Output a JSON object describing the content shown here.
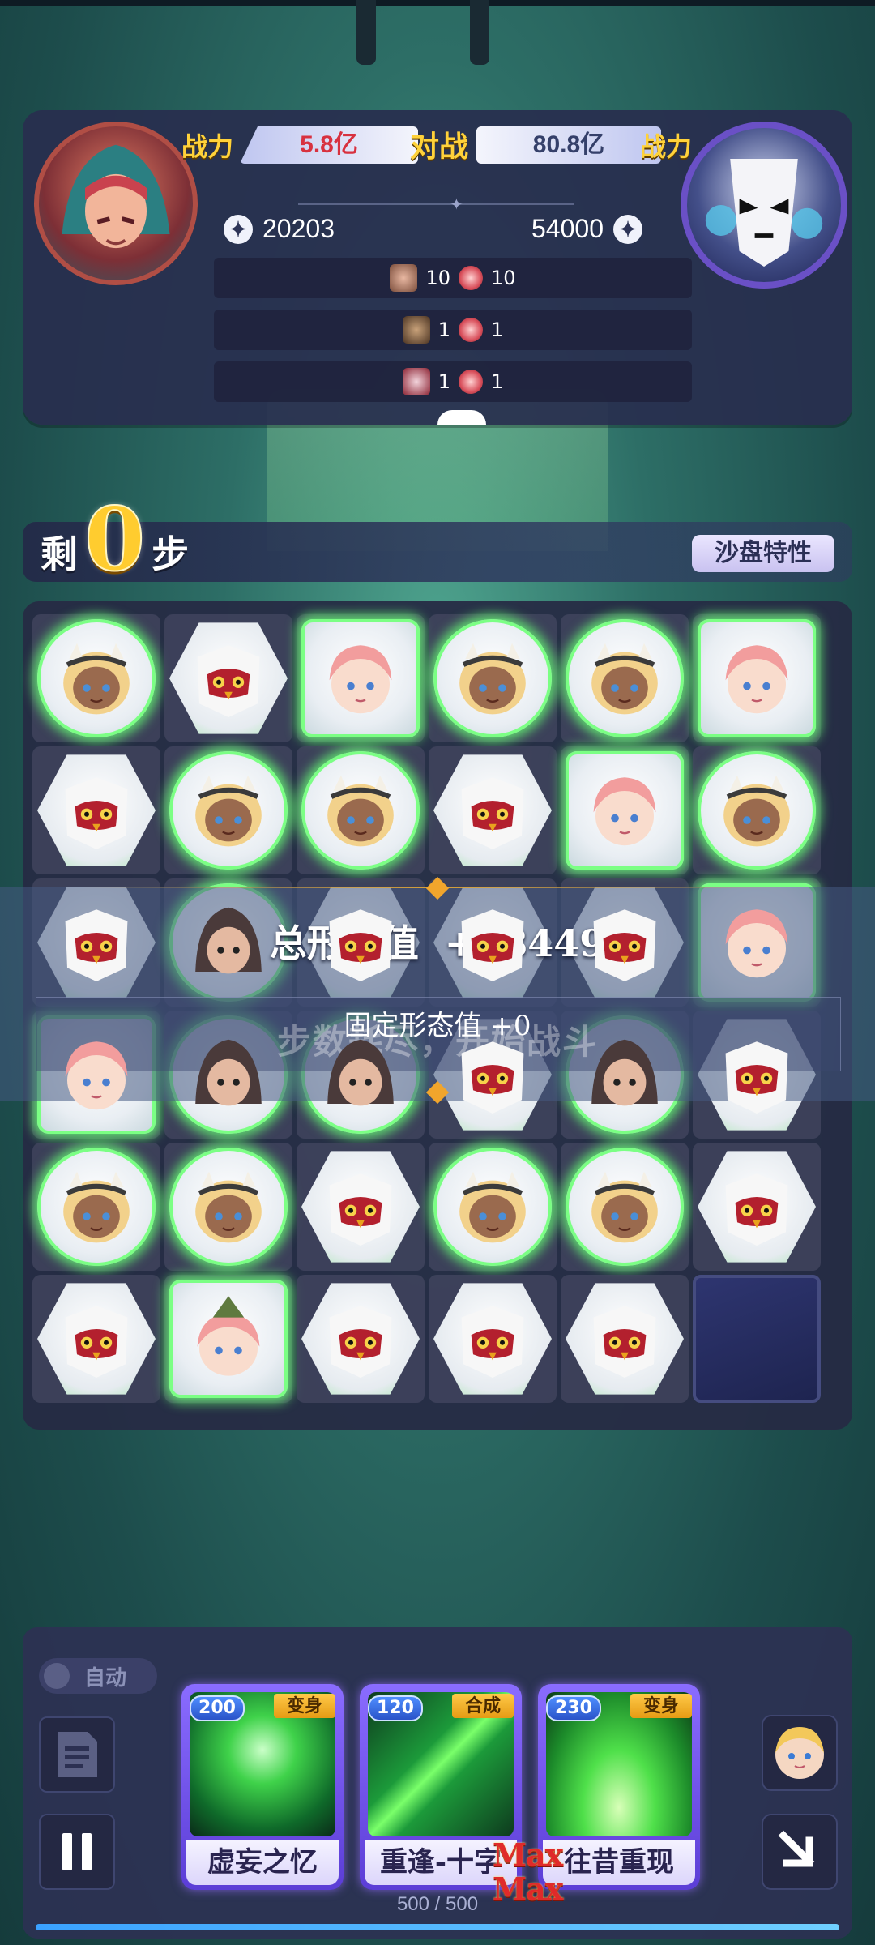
{
  "header": {
    "power_label_left": "战力",
    "power_value_left": "5.8亿",
    "vs_label": "对战",
    "power_value_right": "80.8亿",
    "power_label_right": "战力",
    "score_left": "20203",
    "score_right": "54000",
    "rewards": [
      {
        "hero_count": "10",
        "coin_count": "10"
      },
      {
        "hero_count": "1",
        "coin_count": "1"
      },
      {
        "hero_count": "1",
        "coin_count": "1"
      }
    ]
  },
  "steps": {
    "prefix": "剩",
    "count": "0",
    "suffix": "步",
    "sandbox_button": "沙盘特性"
  },
  "board": {
    "grid": [
      [
        "horned-girl",
        "owl-mask",
        "pink-girl",
        "horned-girl",
        "horned-girl",
        "pink-girl"
      ],
      [
        "owl-mask",
        "horned-girl",
        "horned-girl",
        "owl-mask",
        "pink-girl",
        "horned-girl"
      ],
      [
        "owl-mask",
        "hood-dark",
        "owl-mask",
        "owl-mask",
        "owl-mask",
        "pink-girl"
      ],
      [
        "pink-girl",
        "hood-dark",
        "hood-dark",
        "owl-mask",
        "hood-dark",
        "owl-mask"
      ],
      [
        "horned-girl",
        "horned-girl",
        "owl-mask",
        "horned-girl",
        "horned-girl",
        "owl-mask"
      ],
      [
        "owl-mask",
        "pink-girl-hat",
        "owl-mask",
        "owl-mask",
        "owl-mask",
        "empty"
      ]
    ]
  },
  "overlay": {
    "total_label": "总形态值",
    "total_value": "+38449",
    "fixed_text": "固定形态值 +0",
    "exhaust_text": "步数耗尽，开始战斗"
  },
  "controls": {
    "auto_label": "自动",
    "energy": "500 / 500",
    "energy_fraction": 1.0
  },
  "cards": [
    {
      "cost": "200",
      "tag": "变身",
      "name": "虚妄之忆"
    },
    {
      "cost": "120",
      "tag": "合成",
      "name": "重逢-十字"
    },
    {
      "cost": "230",
      "tag": "变身",
      "name": "往昔重现"
    }
  ],
  "max_badges": [
    "Max",
    "Max"
  ],
  "colors": {
    "glow": "#68ff76",
    "power_left": "#d8313f",
    "gold": "#ffd23a",
    "card_border": "#7a5cff"
  }
}
